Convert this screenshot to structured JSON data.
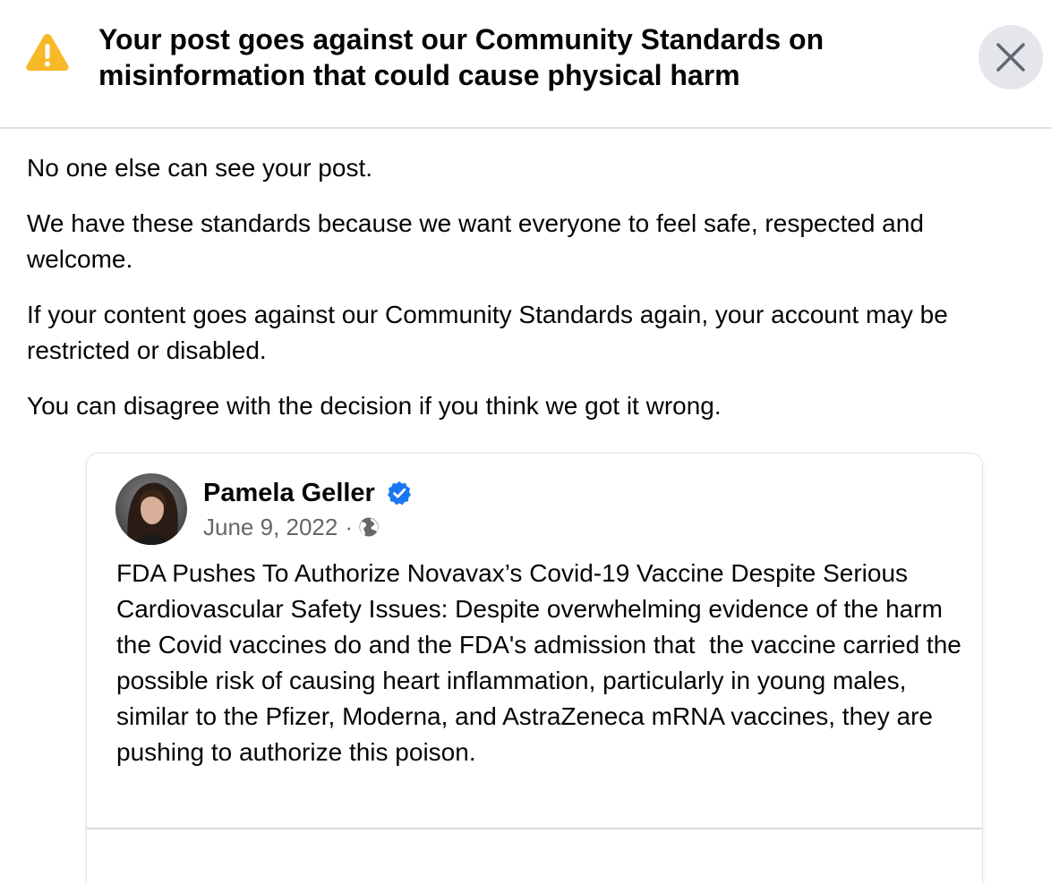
{
  "header": {
    "title": "Your post goes against our Community Standards on misinformation that could cause physical harm",
    "warning_icon": "warning-triangle-icon",
    "close_icon": "close-icon"
  },
  "body": {
    "paragraphs": [
      "No one else can see your post.",
      "We have these standards because we want everyone to feel safe, respected and welcome.",
      "If your content goes against our Community Standards again, your account may be restricted or disabled.",
      "You can disagree with the decision if you think we got it wrong."
    ]
  },
  "post": {
    "author": "Pamela Geller",
    "verified_icon": "verified-badge-icon",
    "date": "June 9, 2022",
    "separator": "·",
    "audience_icon": "globe-icon",
    "text": "FDA Pushes To Authorize Novavax’s Covid-19 Vaccine Despite Serious Cardiovascular Safety Issues: Despite overwhelming evidence of the harm the Covid vaccines do and the FDA's admission that  the vaccine carried the possible risk of causing heart inflammation, particularly in young males, similar to the Pfizer, Moderna, and AstraZeneca mRNA vaccines, they are pushing to authorize this poison."
  },
  "colors": {
    "warning": "#F7B928",
    "verified": "#1877F2",
    "close_bg": "#E4E6EB",
    "secondary_text": "#65676B"
  }
}
